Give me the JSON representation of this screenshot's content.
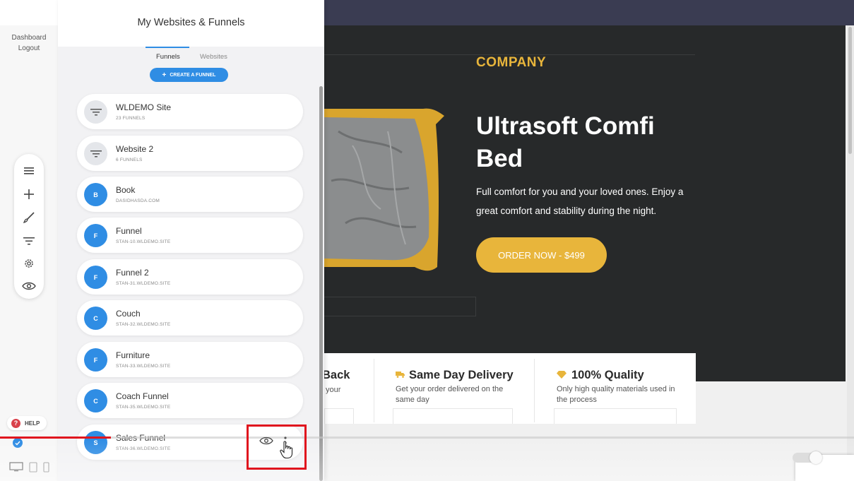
{
  "app": {
    "nav": {
      "dashboard": "Dashboard",
      "logout": "Logout"
    },
    "help_label": "HELP",
    "help_glyph": "?",
    "toolbox_icons": [
      "hamburger-icon",
      "plus-icon",
      "brush-icon",
      "filter-icon",
      "gear-icon",
      "eye-icon"
    ],
    "device_icons": [
      "desktop-icon",
      "tablet-icon",
      "mobile-icon"
    ]
  },
  "panel": {
    "title": "My Websites & Funnels",
    "tabs": [
      {
        "label": "Funnels",
        "active": true
      },
      {
        "label": "Websites",
        "active": false
      }
    ],
    "create_label": "CREATE A FUNNEL",
    "items": [
      {
        "name": "WLDEMO Site",
        "sub": "23 FUNNELS",
        "avatar": "funnel"
      },
      {
        "name": "Website 2",
        "sub": "6 FUNNELS",
        "avatar": "funnel"
      },
      {
        "name": "Book",
        "sub": "DASIDHASDA.COM",
        "avatar": "B"
      },
      {
        "name": "Funnel",
        "sub": "STAN-10.WLDEMO.SITE",
        "avatar": "F"
      },
      {
        "name": "Funnel 2",
        "sub": "STAN-31.WLDEMO.SITE",
        "avatar": "F"
      },
      {
        "name": "Couch",
        "sub": "STAN-32.WLDEMO.SITE",
        "avatar": "C"
      },
      {
        "name": "Furniture",
        "sub": "STAN-33.WLDEMO.SITE",
        "avatar": "F"
      },
      {
        "name": "Coach Funnel",
        "sub": "STAN-35.WLDEMO.SITE",
        "avatar": "C"
      },
      {
        "name": "Sales Funnel",
        "sub": "STAN-36.WLDEMO.SITE",
        "avatar": "S",
        "selected": true
      }
    ]
  },
  "preview": {
    "company": "COMPANY",
    "title": "Ultrasoft Comfi Bed",
    "description": "Full comfort for you and your loved ones. Enjoy a great comfort and stability during the night.",
    "cta": "ORDER NOW - $499",
    "features": [
      {
        "title": "Back",
        "desc": "your"
      },
      {
        "title": "Same Day Delivery",
        "desc": "Get your order delivered on the same day",
        "icon": "truck-icon"
      },
      {
        "title": "100% Quality",
        "desc": "Only high quality materials used in the process",
        "icon": "diamond-icon"
      }
    ]
  },
  "colors": {
    "accent": "#2f8de4",
    "gold": "#e8b53b",
    "hero_bg": "#27292a",
    "highlight": "#e0151e"
  },
  "video": {
    "progress": 0.13
  }
}
